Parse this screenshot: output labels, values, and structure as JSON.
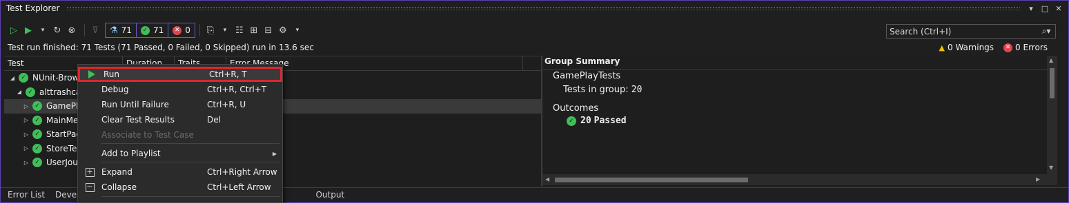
{
  "window": {
    "title": "Test Explorer",
    "controls": [
      "▾",
      "□",
      "✕"
    ]
  },
  "toolbar": {
    "badges": {
      "total": "71",
      "passed": "71",
      "failed": "0"
    },
    "search_placeholder": "Search (Ctrl+I)"
  },
  "status": {
    "summary": "Test run finished: 71 Tests (71 Passed, 0 Failed, 0 Skipped) run in 13.6 sec",
    "warnings": "0 Warnings",
    "errors": "0 Errors"
  },
  "columns": [
    "Test",
    "Duration",
    "Traits",
    "Error Message"
  ],
  "tree": [
    {
      "label": "NUnit-Brows",
      "level": 0
    },
    {
      "label": "alttrashcat_",
      "level": 1
    },
    {
      "label": "GamePlay",
      "level": 2
    },
    {
      "label": "MainMen",
      "level": 2
    },
    {
      "label": "StartPage",
      "level": 2
    },
    {
      "label": "StoreTest",
      "level": 2
    },
    {
      "label": "UserJourn",
      "level": 2
    }
  ],
  "group_summary": {
    "title": "Group Summary",
    "name": "GamePlayTests",
    "tests_label": "Tests in group:",
    "tests_count": "20",
    "outcomes_label": "Outcomes",
    "passed_count": "20",
    "passed_label": "Passed"
  },
  "bottom_tabs": [
    "Error List",
    "Develop",
    "Output"
  ],
  "context_menu": {
    "run": {
      "label": "Run",
      "shortcut": "Ctrl+R, T"
    },
    "debug": {
      "label": "Debug",
      "shortcut": "Ctrl+R, Ctrl+T"
    },
    "run_until_failure": {
      "label": "Run Until Failure",
      "shortcut": "Ctrl+R, U"
    },
    "clear_results": {
      "label": "Clear Test Results",
      "shortcut": "Del"
    },
    "associate": {
      "label": "Associate to Test Case"
    },
    "add_playlist": {
      "label": "Add to Playlist"
    },
    "expand": {
      "label": "Expand",
      "shortcut": "Ctrl+Right Arrow"
    },
    "collapse": {
      "label": "Collapse",
      "shortcut": "Ctrl+Left Arrow"
    }
  },
  "colors": {
    "accent": "#6b5bd3",
    "pass": "#3fbf5a",
    "error": "#e0464e",
    "highlight": "#e0252d"
  }
}
